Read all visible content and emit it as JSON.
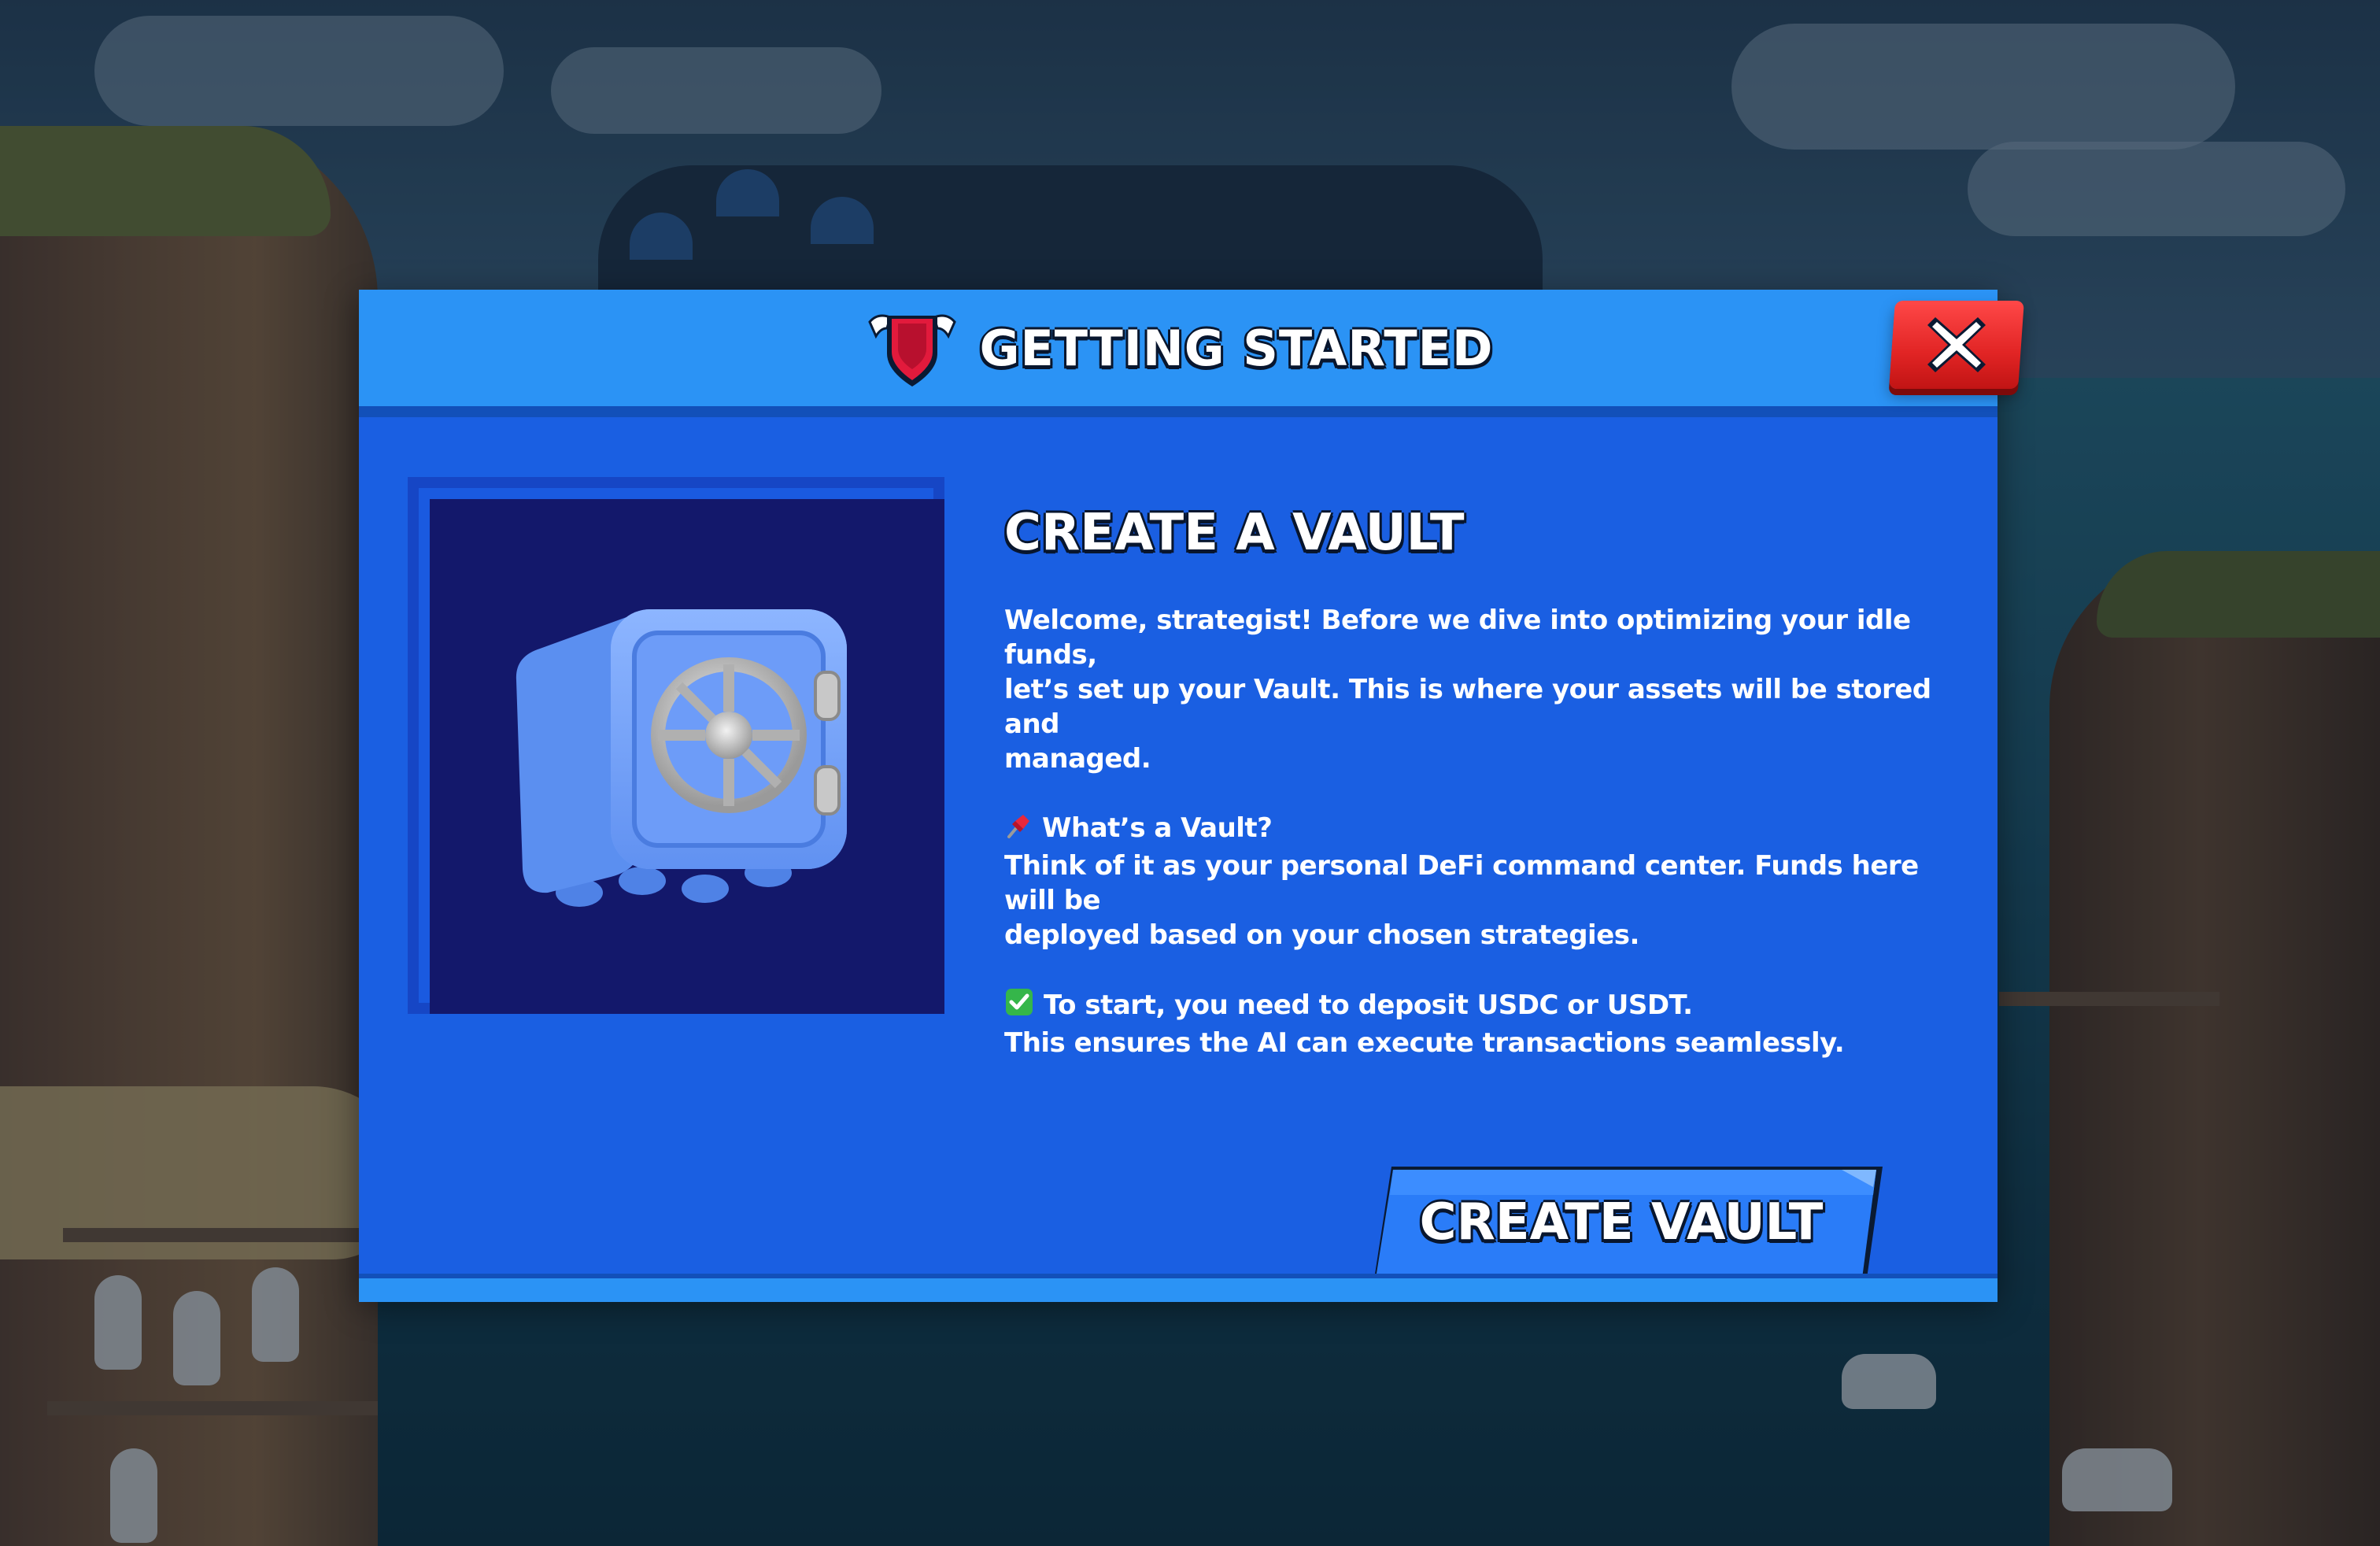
{
  "modal": {
    "title": "GETTING STARTED",
    "close_icon": "close-icon"
  },
  "illustration": {
    "icon": "vault-icon"
  },
  "content": {
    "title": "CREATE A VAULT",
    "intro_lines": [
      "Welcome, strategist! Before we dive into optimizing your idle funds,",
      "let’s set up your Vault. This is where your assets will be stored and",
      "managed."
    ],
    "vault_heading": "What’s a Vault?",
    "vault_lines": [
      "Think of it as your personal DeFi command center. Funds here will be",
      "deployed based on your chosen strategies."
    ],
    "deposit_heading": "To start, you need to deposit USDC or USDT.",
    "deposit_line": "This ensures the AI can execute transactions seamlessly."
  },
  "cta": {
    "label": "CREATE VAULT"
  },
  "colors": {
    "panel": "#1a5fe2",
    "header": "#2b93f5",
    "close": "#e12424",
    "illustration_bg": "#13186b"
  }
}
